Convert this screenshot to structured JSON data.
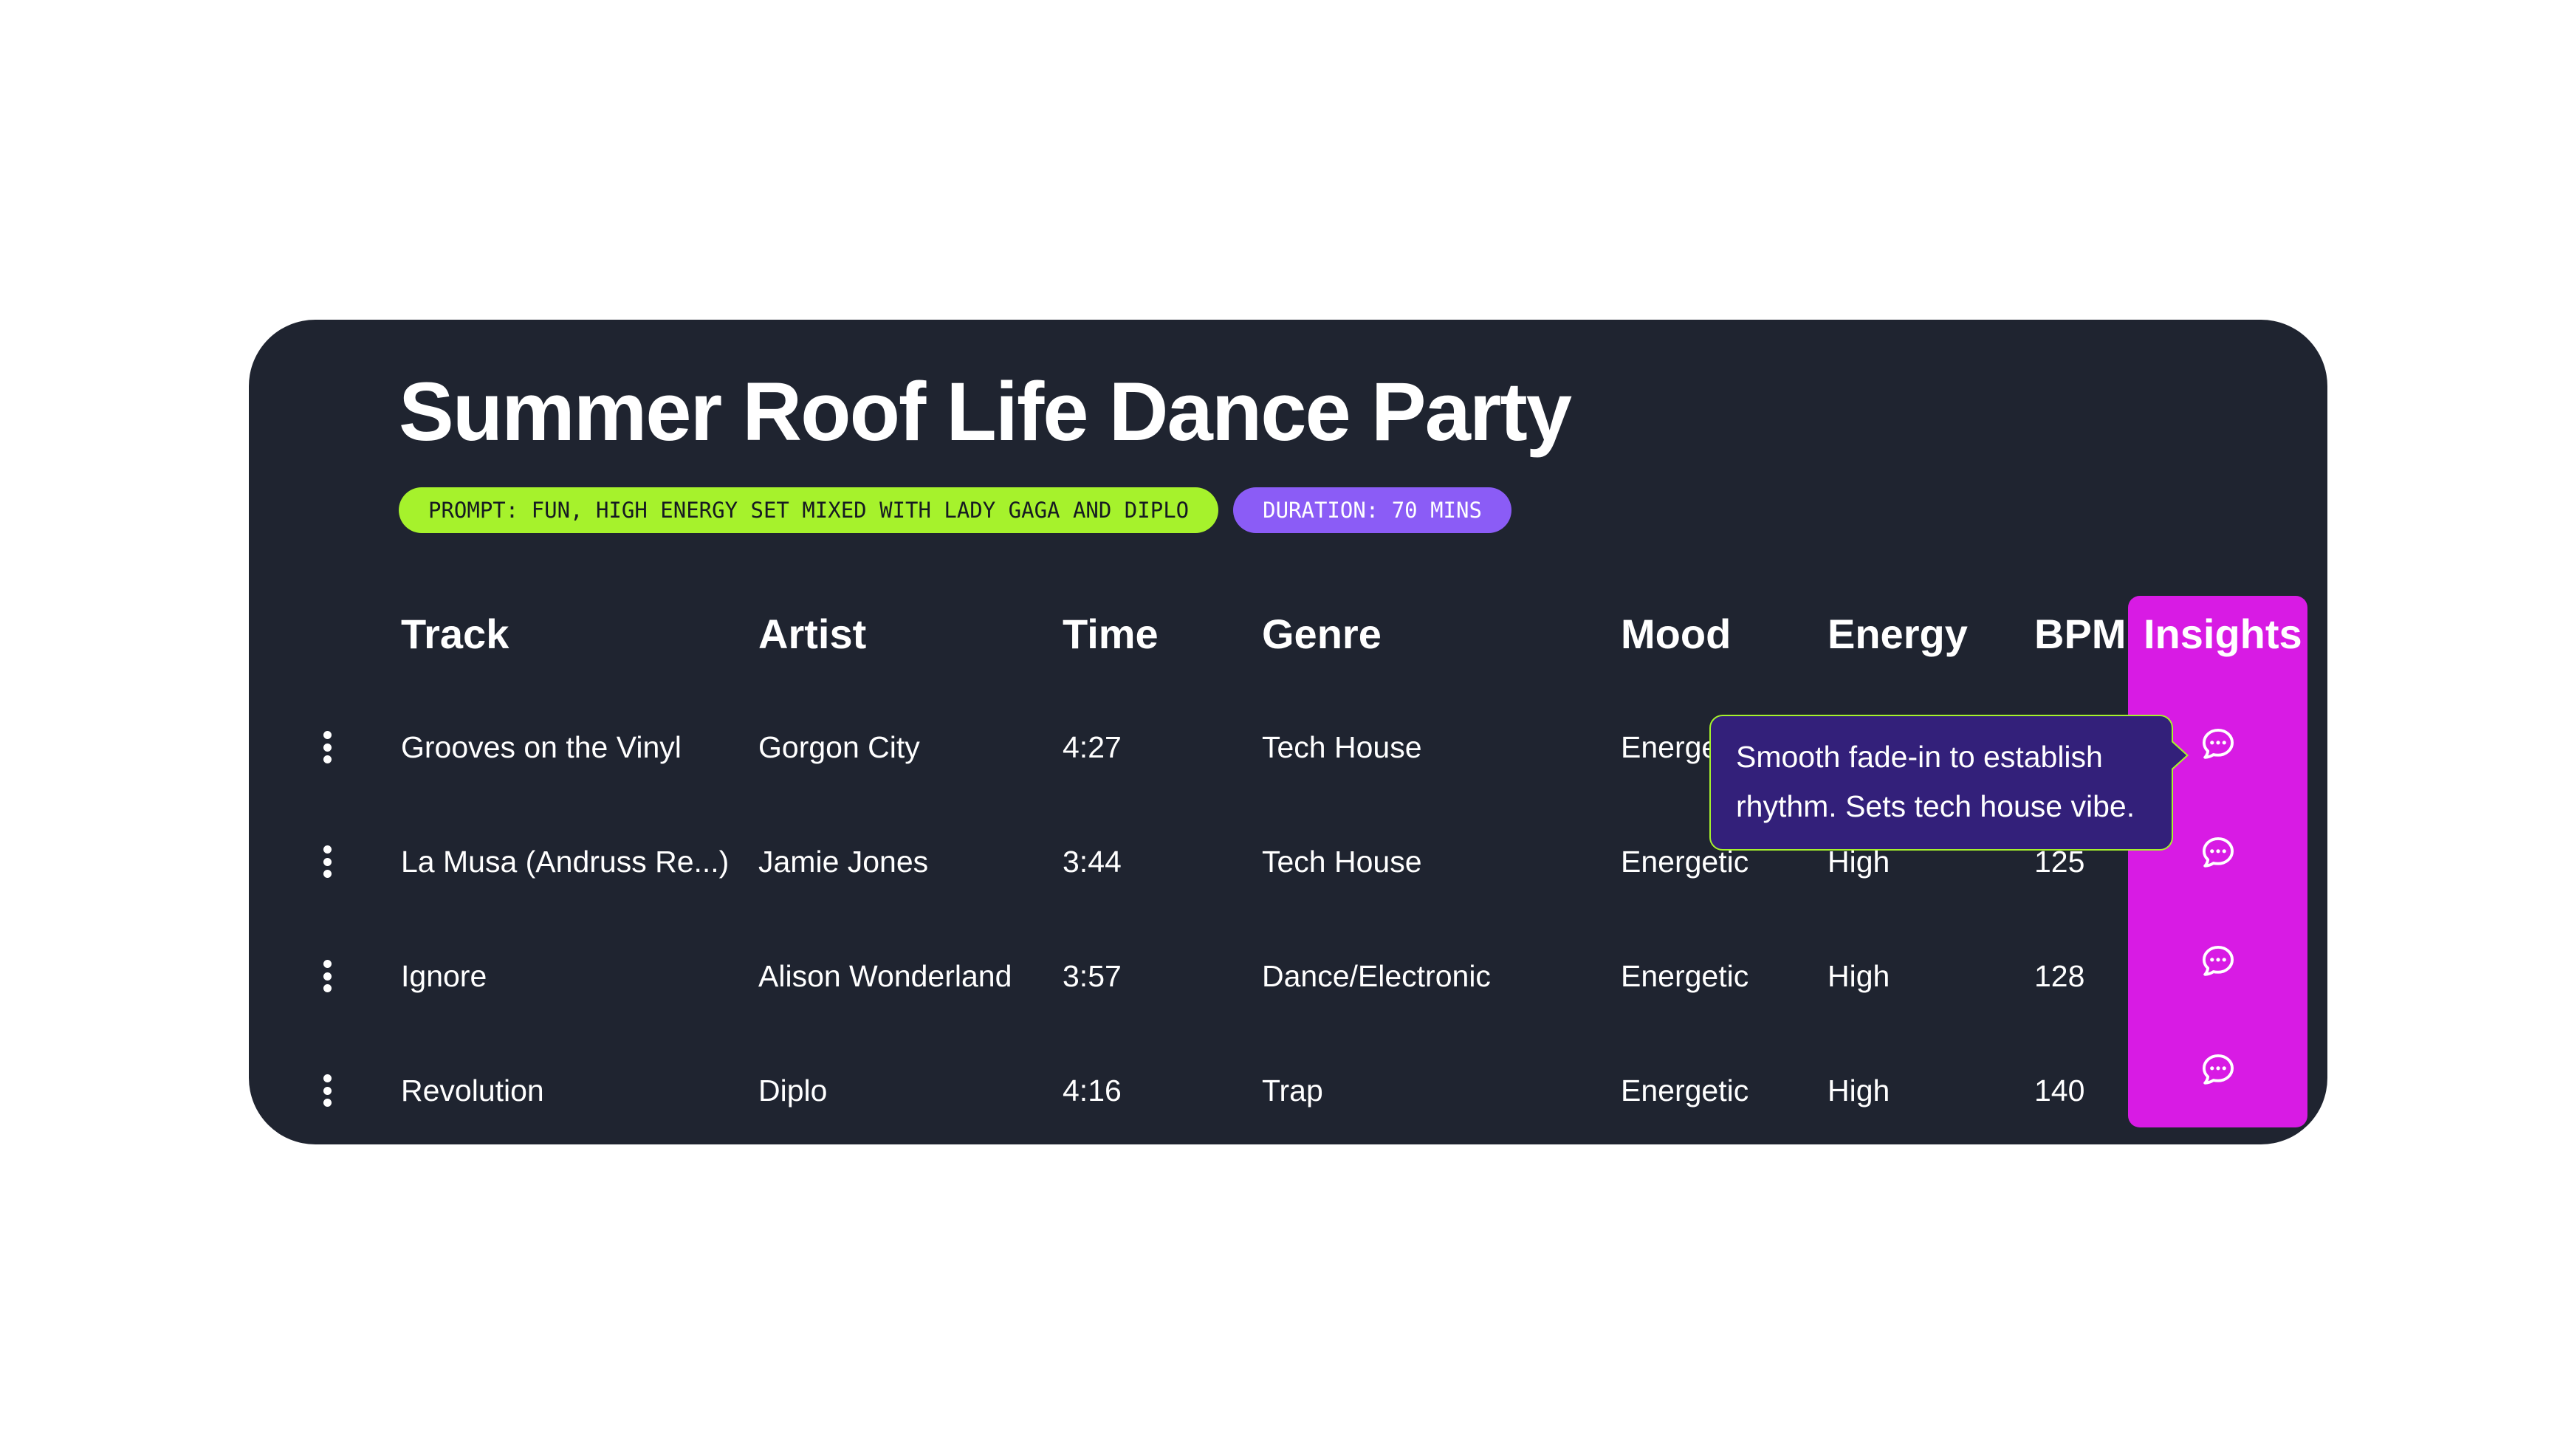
{
  "title": "Summer Roof Life Dance Party",
  "tags": {
    "prompt": "PROMPT: FUN, HIGH ENERGY SET MIXED WITH LADY GAGA AND DIPLO",
    "duration": "DURATION: 70 MINS"
  },
  "columns": {
    "track": "Track",
    "artist": "Artist",
    "time": "Time",
    "genre": "Genre",
    "mood": "Mood",
    "energy": "Energy",
    "bpm": "BPM",
    "insights": "Insights"
  },
  "rows": [
    {
      "track": "Grooves on the Vinyl",
      "artist": "Gorgon City",
      "time": "4:27",
      "genre": "Tech House",
      "mood": "Energetic",
      "energy": "",
      "bpm": ""
    },
    {
      "track": "La Musa (Andruss Re...)",
      "artist": "Jamie Jones",
      "time": "3:44",
      "genre": "Tech House",
      "mood": "Energetic",
      "energy": "High",
      "bpm": "125"
    },
    {
      "track": "Ignore",
      "artist": "Alison Wonderland",
      "time": "3:57",
      "genre": "Dance/Electronic",
      "mood": "Energetic",
      "energy": "High",
      "bpm": "128"
    },
    {
      "track": "Revolution",
      "artist": "Diplo",
      "time": "4:16",
      "genre": "Trap",
      "mood": "Energetic",
      "energy": "High",
      "bpm": "140"
    }
  ],
  "tooltip": {
    "line1": "Smooth fade-in to establish",
    "line2": "rhythm. Sets tech house vibe."
  },
  "icons": {
    "row_menu": "kebab-menu-icon",
    "insight": "chat-bubble-icon"
  },
  "colors": {
    "card_bg": "#1f2430",
    "prompt_tag": "#a6f22c",
    "duration_tag": "#8b5cf6",
    "insights_column": "#d81be4",
    "tooltip_bg": "#33207a",
    "tooltip_border": "#a6f22c"
  }
}
